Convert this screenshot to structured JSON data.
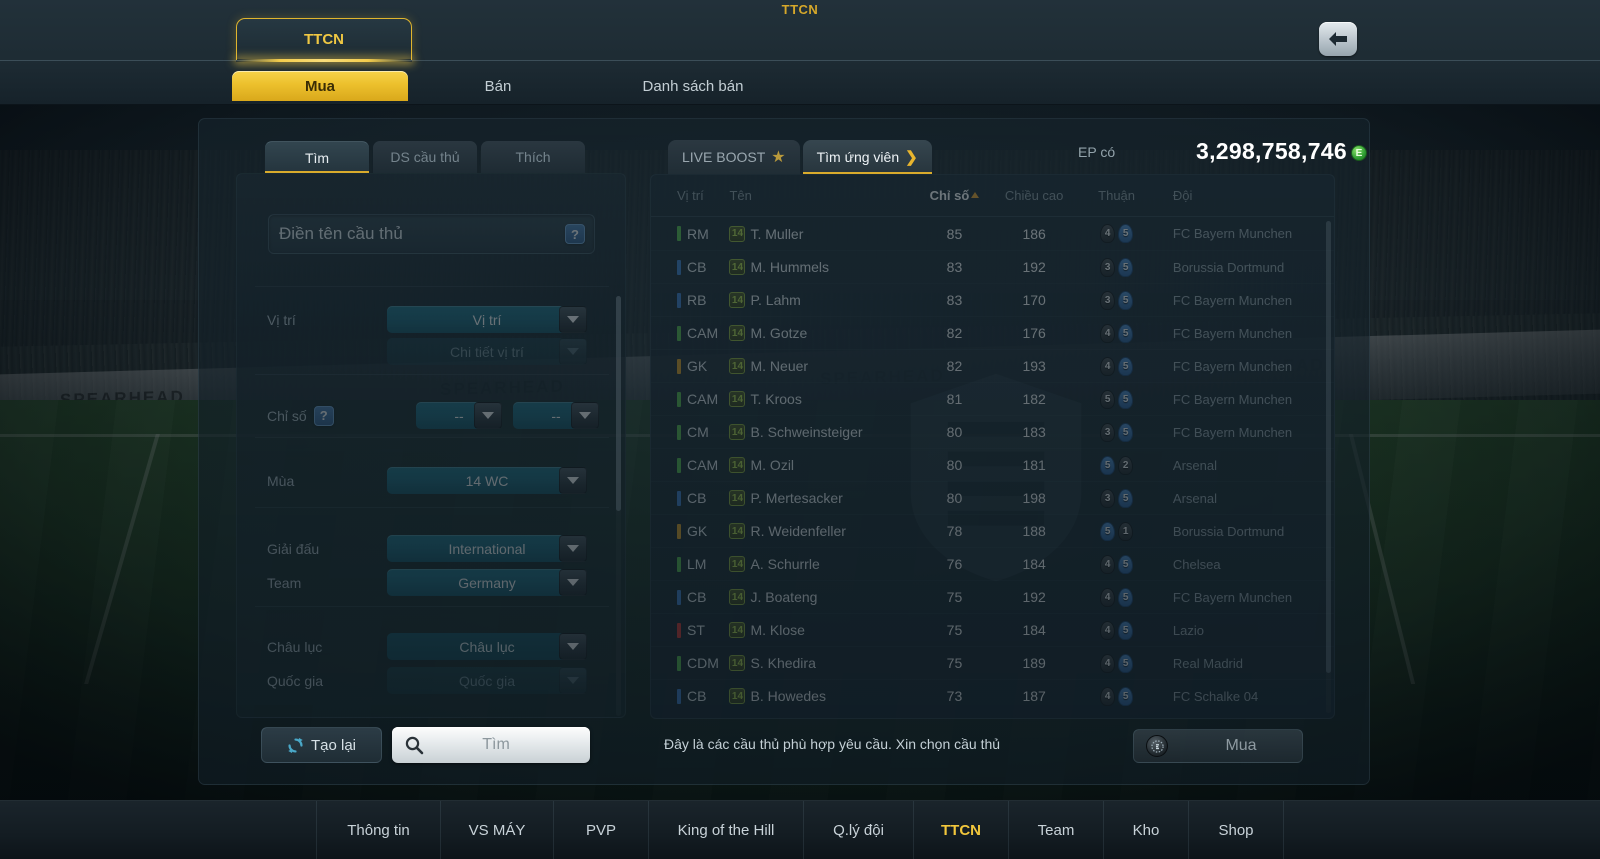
{
  "window": {
    "title": "TTCN",
    "back_icon": "back-arrow-icon"
  },
  "header": {
    "module_tab": "TTCN",
    "tabs": [
      {
        "label": "Mua",
        "active": true
      },
      {
        "label": "Bán",
        "active": false
      },
      {
        "label": "Danh sách bán",
        "active": false
      }
    ]
  },
  "search_panel": {
    "tabs": [
      {
        "label": "Tìm",
        "active": true
      },
      {
        "label": "DS cầu thủ",
        "active": false
      },
      {
        "label": "Thích",
        "active": false
      }
    ],
    "name_input": {
      "value": "",
      "placeholder": "Điền tên cầu thủ",
      "help_icon": "question-mark-icon",
      "help_label": "?"
    },
    "fields": [
      {
        "key": "position",
        "label": "Vị trí",
        "value": "Vị trí",
        "enabled": true
      },
      {
        "key": "position_detail",
        "label": "",
        "value": "Chi tiết vị trí",
        "enabled": false
      },
      {
        "key": "stat_help",
        "label": "Chỉ số",
        "value": "?",
        "enabled": true
      },
      {
        "key": "stat_a",
        "label": "",
        "value": "--",
        "enabled": true
      },
      {
        "key": "stat_b",
        "label": "",
        "value": "--",
        "enabled": true
      },
      {
        "key": "season",
        "label": "Mùa",
        "value": "14 WC",
        "enabled": true
      },
      {
        "key": "league",
        "label": "Giải đấu",
        "value": "International",
        "enabled": true
      },
      {
        "key": "team",
        "label": "Team",
        "value": "Germany",
        "enabled": true
      },
      {
        "key": "continent",
        "label": "Châu lục",
        "value": "Châu lục",
        "enabled": true
      },
      {
        "key": "country",
        "label": "Quốc gia",
        "value": "Quốc gia",
        "enabled": false
      }
    ],
    "reset_button": {
      "label": "Tạo lại",
      "icon": "refresh-icon"
    },
    "find_button": {
      "label": "Tìm",
      "icon": "search-icon"
    }
  },
  "results_panel": {
    "tabs": [
      {
        "label": "LIVE BOOST",
        "icon": "star-icon",
        "active": false
      },
      {
        "label": "Tìm ứng viên",
        "icon": "chevron-right-icon",
        "active": true
      }
    ],
    "currency": {
      "label": "EP có",
      "value": "3,298,758,746",
      "coin_icon": "ep-coin-icon",
      "coin_glyph": "E"
    },
    "columns": [
      {
        "key": "position",
        "label": "Vị trí",
        "sorted": false
      },
      {
        "key": "name",
        "label": "Tên",
        "sorted": false
      },
      {
        "key": "rating",
        "label": "Chỉ số",
        "sorted": true,
        "direction": "asc"
      },
      {
        "key": "height",
        "label": "Chiều cao",
        "sorted": false
      },
      {
        "key": "foot",
        "label": "Thuận",
        "sorted": false
      },
      {
        "key": "team",
        "label": "Đội",
        "sorted": false
      }
    ],
    "position_colors": {
      "GK": "#e0a022",
      "CB": "#3c7fd0",
      "RB": "#3c7fd0",
      "RM": "#55bf4a",
      "LM": "#55bf4a",
      "CM": "#55bf4a",
      "CAM": "#55bf4a",
      "CDM": "#55bf4a",
      "ST": "#d8342c"
    },
    "season_badge": "14",
    "rows": [
      {
        "position": "RM",
        "name": "T. Muller",
        "rating": "85",
        "height": "186",
        "foot_left": "4",
        "foot_right": "5",
        "foot_dominant": "right",
        "team": "FC Bayern Munchen"
      },
      {
        "position": "CB",
        "name": "M. Hummels",
        "rating": "83",
        "height": "192",
        "foot_left": "3",
        "foot_right": "5",
        "foot_dominant": "right",
        "team": "Borussia Dortmund"
      },
      {
        "position": "RB",
        "name": "P. Lahm",
        "rating": "83",
        "height": "170",
        "foot_left": "3",
        "foot_right": "5",
        "foot_dominant": "right",
        "team": "FC Bayern Munchen"
      },
      {
        "position": "CAM",
        "name": "M. Gotze",
        "rating": "82",
        "height": "176",
        "foot_left": "4",
        "foot_right": "5",
        "foot_dominant": "right",
        "team": "FC Bayern Munchen"
      },
      {
        "position": "GK",
        "name": "M. Neuer",
        "rating": "82",
        "height": "193",
        "foot_left": "4",
        "foot_right": "5",
        "foot_dominant": "right",
        "team": "FC Bayern Munchen"
      },
      {
        "position": "CAM",
        "name": "T. Kroos",
        "rating": "81",
        "height": "182",
        "foot_left": "5",
        "foot_right": "5",
        "foot_dominant": "right",
        "team": "FC Bayern Munchen"
      },
      {
        "position": "CM",
        "name": "B. Schweinsteiger",
        "rating": "80",
        "height": "183",
        "foot_left": "3",
        "foot_right": "5",
        "foot_dominant": "right",
        "team": "FC Bayern Munchen"
      },
      {
        "position": "CAM",
        "name": "M. Ozil",
        "rating": "80",
        "height": "181",
        "foot_left": "5",
        "foot_right": "2",
        "foot_dominant": "left",
        "team": "Arsenal"
      },
      {
        "position": "CB",
        "name": "P. Mertesacker",
        "rating": "80",
        "height": "198",
        "foot_left": "3",
        "foot_right": "5",
        "foot_dominant": "right",
        "team": "Arsenal"
      },
      {
        "position": "GK",
        "name": "R. Weidenfeller",
        "rating": "78",
        "height": "188",
        "foot_left": "5",
        "foot_right": "1",
        "foot_dominant": "left",
        "team": "Borussia Dortmund"
      },
      {
        "position": "LM",
        "name": "A. Schurrle",
        "rating": "76",
        "height": "184",
        "foot_left": "4",
        "foot_right": "5",
        "foot_dominant": "right",
        "team": "Chelsea"
      },
      {
        "position": "CB",
        "name": "J. Boateng",
        "rating": "75",
        "height": "192",
        "foot_left": "4",
        "foot_right": "5",
        "foot_dominant": "right",
        "team": "FC Bayern Munchen"
      },
      {
        "position": "ST",
        "name": "M. Klose",
        "rating": "75",
        "height": "184",
        "foot_left": "4",
        "foot_right": "5",
        "foot_dominant": "right",
        "team": "Lazio"
      },
      {
        "position": "CDM",
        "name": "S. Khedira",
        "rating": "75",
        "height": "189",
        "foot_left": "4",
        "foot_right": "5",
        "foot_dominant": "right",
        "team": "Real Madrid"
      },
      {
        "position": "CB",
        "name": "B. Howedes",
        "rating": "73",
        "height": "187",
        "foot_left": "4",
        "foot_right": "5",
        "foot_dominant": "right",
        "team": "FC Schalke 04"
      }
    ],
    "hint": "Đây là các cầu thủ phù hợp yêu cầu. Xin chọn cầu thủ",
    "buy_button": {
      "label": "Mua",
      "icon": "ep-coin-icon",
      "enabled": false
    }
  },
  "bottom_nav": [
    {
      "label": "Thông tin",
      "active": false
    },
    {
      "label": "VS MÁY",
      "active": false
    },
    {
      "label": "PVP",
      "active": false
    },
    {
      "label": "King of the Hill",
      "active": false
    },
    {
      "label": "Q.lý đội",
      "active": false
    },
    {
      "label": "TTCN",
      "active": true
    },
    {
      "label": "Team",
      "active": false
    },
    {
      "label": "Kho",
      "active": false
    },
    {
      "label": "Shop",
      "active": false
    }
  ],
  "background_boards": [
    "SPEARHEAD",
    "SPEARHEAD",
    "SPEARHEAD",
    "SPEARHEAD"
  ],
  "colors": {
    "gold": "#f0c843",
    "teal": "#17657a",
    "panel": "#1a2832"
  }
}
